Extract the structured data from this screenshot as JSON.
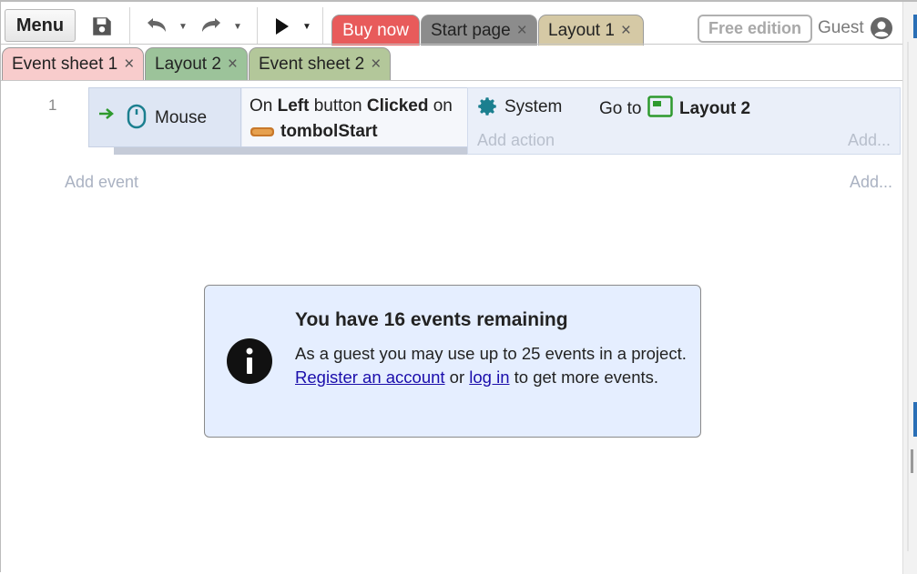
{
  "toolbar": {
    "menu_label": "Menu",
    "tabs": [
      {
        "label": "Buy now"
      },
      {
        "label": "Start page",
        "close": "×"
      },
      {
        "label": "Layout 1",
        "close": "×"
      }
    ],
    "free_edition_label": "Free edition",
    "guest_label": "Guest"
  },
  "sheet_tabs": [
    {
      "label": "Event sheet 1",
      "close": "×"
    },
    {
      "label": "Layout 2",
      "close": "×"
    },
    {
      "label": "Event sheet 2",
      "close": "×"
    }
  ],
  "event": {
    "number": "1",
    "condition_object": "Mouse",
    "condition_text_1": "On ",
    "condition_button": "Left",
    "condition_text_2": " button ",
    "condition_clicked": "Clicked",
    "condition_text_3": " on",
    "condition_target": "tombolStart",
    "action_object": "System",
    "action_text": "Go to",
    "action_target": "Layout 2",
    "add_action": "Add action",
    "add_action_right": "Add..."
  },
  "add_event": "Add event",
  "add_event_right": "Add...",
  "notice": {
    "title": "You have 16 events remaining",
    "body_1": "As a guest you may use up to 25 events in a project. ",
    "register_link": "Register an account",
    "body_2": " or ",
    "login_link": "log in",
    "body_3": " to get more events."
  },
  "colors": {
    "buy_tab": "#e85b5b",
    "event_sheet_tab": "#f8cccc",
    "layout_tab": "#9cc39a",
    "notice_bg": "#e5eeff",
    "accent_teal": "#1b7f8f",
    "accent_green": "#2e9a2e"
  }
}
